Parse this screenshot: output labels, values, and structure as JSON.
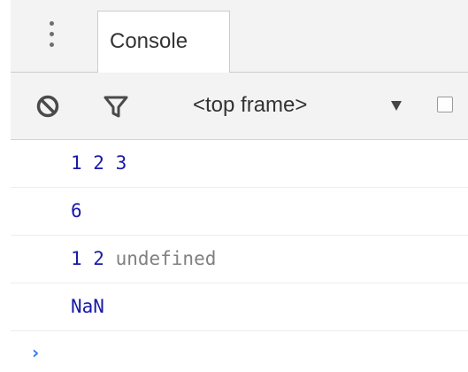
{
  "tabs": [
    {
      "label": "Console",
      "active": true
    }
  ],
  "icons": {
    "menu": "vertical-dots-icon",
    "clear": "clear-console-icon",
    "filter": "filter-icon",
    "dropdown": "caret-down-icon",
    "prompt": "prompt-chevron-icon"
  },
  "toolbar": {
    "frame_select_value": "<top frame>",
    "preserve_log_checked": false
  },
  "console": {
    "lines": [
      {
        "text": "1 2 3"
      },
      {
        "text": "6"
      },
      {
        "text": "1 2 ",
        "muted": "undefined"
      },
      {
        "text": "NaN"
      }
    ],
    "prompt_symbol": "›"
  },
  "colors": {
    "log_value": "#1a1aa6",
    "undefined_value": "#808080",
    "prompt": "#367cf1",
    "toolbar_bg": "#f3f3f3"
  }
}
